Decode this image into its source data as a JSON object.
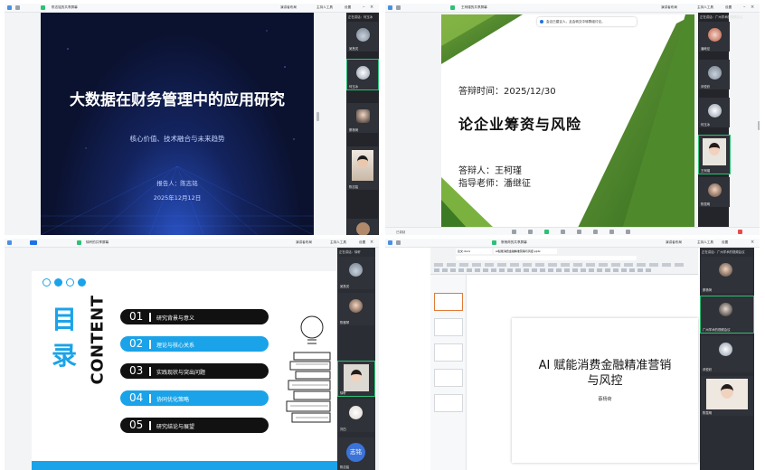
{
  "q1": {
    "meeting_title": "陈志铭的共享屏幕",
    "toolbar": {
      "speaker": "演讲者布局",
      "host": "主持人工具",
      "settings": "设置"
    },
    "slide": {
      "title": "大数据在财务管理中的应用研究",
      "subtitle": "核心价值、技术融合与未来趋势",
      "reporter": "报告人：陈志铭",
      "date": "2025年12月12日"
    },
    "gallery": {
      "header": "正在讲话：何玉冰",
      "participants": [
        "吴慧灵",
        "何玉冰",
        "蔡杨荷",
        "陈志铭"
      ]
    }
  },
  "q2": {
    "meeting_title": "王柯瑾的共享屏幕",
    "banner": "会议已建议人，且会转交中转群组讨论。",
    "toolbar": {
      "speaker": "演讲者布局",
      "host": "主持人工具",
      "settings": "设置"
    },
    "slide": {
      "date_line": "答辩时间：2025/12/30",
      "title": "论企业筹资与风险",
      "defender": "答辩人：王柯瑾",
      "advisor": "指导老师：潘继征"
    },
    "gallery": {
      "header": "正在讲话：广州学术的视频会议",
      "participants": [
        "潘继征",
        "邓悦欣",
        "何玉冰",
        "王柯瑾",
        "陈昆明"
      ]
    },
    "bottom_left": "已录制"
  },
  "q3": {
    "meeting_title": "徐轩的共享屏幕",
    "toolbar": {
      "speaker": "演讲者布局",
      "host": "主持人工具",
      "settings": "设置"
    },
    "slide": {
      "heading_cn": "目录",
      "heading_en": "CONTENT",
      "items": [
        {
          "num": "01",
          "label": "研究背景与意义",
          "style": "dark"
        },
        {
          "num": "02",
          "label": "理论与核心关系",
          "style": "blue"
        },
        {
          "num": "03",
          "label": "实践现状与突出问题",
          "style": "dark"
        },
        {
          "num": "04",
          "label": "协同优化策略",
          "style": "blue"
        },
        {
          "num": "05",
          "label": "研究结论与展望",
          "style": "dark"
        }
      ]
    },
    "gallery": {
      "header": "正在讲话：徐轩",
      "participants": [
        "吴慧灵",
        "陈雅琴",
        "徐轩",
        "刘白",
        "陈志铭"
      ],
      "avatar_text": "志铭"
    }
  },
  "q4": {
    "meeting_title": "蔡杨荷的共享屏幕",
    "toolbar": {
      "speaker": "演讲者布局",
      "host": "主持人工具",
      "settings": "设置"
    },
    "tabs": [
      "论文.docx",
      "AI赋能消费金融精准营销与风控.pptx"
    ],
    "slide": {
      "title_line1": "AI 赋能消费金融精准营销",
      "title_line2": "与风控",
      "presenter": "蔡杨荷"
    },
    "gallery": {
      "header": "正在讲话：广州学术的视频会议",
      "participants": [
        "蔡杨荷",
        "广州学术的视频会议",
        "邓悦欣",
        "陈昆明"
      ]
    }
  },
  "colors": {
    "accent_blue": "#1aa3e8",
    "green": "#2bc275",
    "dark_slide": "#0b1230"
  }
}
